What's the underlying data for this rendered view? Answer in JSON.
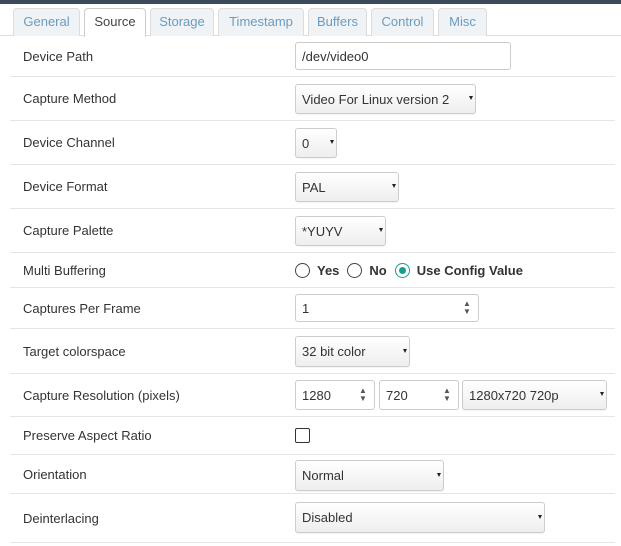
{
  "tabs": [
    {
      "label": "General",
      "active": false
    },
    {
      "label": "Source",
      "active": true
    },
    {
      "label": "Storage",
      "active": false
    },
    {
      "label": "Timestamp",
      "active": false
    },
    {
      "label": "Buffers",
      "active": false
    },
    {
      "label": "Control",
      "active": false
    },
    {
      "label": "Misc",
      "active": false
    }
  ],
  "fields": {
    "device_path": {
      "label": "Device Path",
      "value": "/dev/video0"
    },
    "capture_method": {
      "label": "Capture Method",
      "value": "Video For Linux version 2"
    },
    "device_channel": {
      "label": "Device Channel",
      "value": "0"
    },
    "device_format": {
      "label": "Device Format",
      "value": "PAL"
    },
    "capture_palette": {
      "label": "Capture Palette",
      "value": "*YUYV"
    },
    "multi_buffering": {
      "label": "Multi Buffering",
      "options": [
        "Yes",
        "No",
        "Use Config Value"
      ],
      "selected": "Use Config Value"
    },
    "captures_per_frame": {
      "label": "Captures Per Frame",
      "value": "1"
    },
    "target_colorspace": {
      "label": "Target colorspace",
      "value": "32 bit color"
    },
    "capture_resolution": {
      "label": "Capture Resolution (pixels)",
      "width": "1280",
      "height": "720",
      "preset": "1280x720 720p"
    },
    "preserve_aspect": {
      "label": "Preserve Aspect Ratio",
      "checked": false
    },
    "orientation": {
      "label": "Orientation",
      "value": "Normal"
    },
    "deinterlacing": {
      "label": "Deinterlacing",
      "value": "Disabled"
    }
  },
  "colors": {
    "accent": "#1a9b8c",
    "tab_text": "#6a9bbf",
    "header_bar": "#3a4a5a"
  }
}
